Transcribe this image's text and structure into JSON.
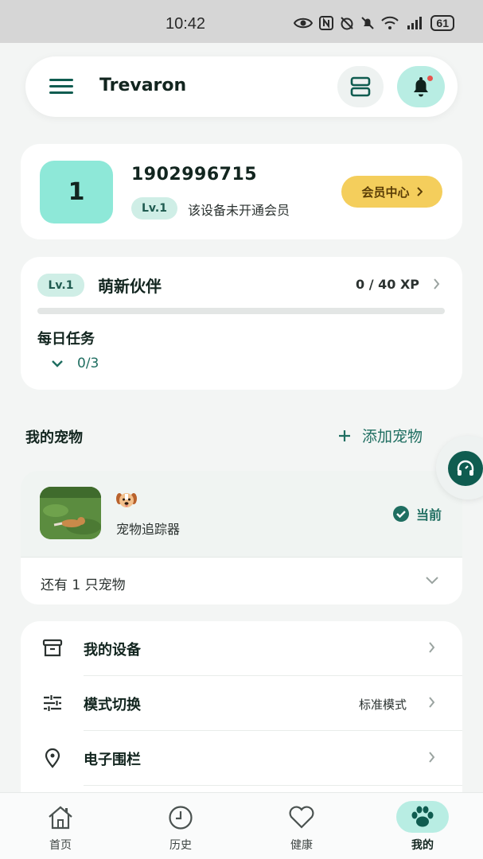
{
  "status_bar": {
    "time": "10:42",
    "battery": "61"
  },
  "header": {
    "app_name": "Trevaron"
  },
  "profile": {
    "avatar_text": "1",
    "user_id": "1902996715",
    "level_badge": "Lv.1",
    "member_status": "该设备未开通会员",
    "vip_button": "会员中心"
  },
  "level": {
    "badge": "Lv.1",
    "title": "萌新伙伴",
    "xp_text": "0 / 40 XP",
    "progress": 0,
    "daily_tasks_title": "每日任务",
    "daily_tasks_count": "0/3"
  },
  "pets": {
    "section_title": "我的宠物",
    "add_label": "添加宠物",
    "current_pet": {
      "emoji": "🐶",
      "name": "宠物追踪器",
      "status": "当前"
    },
    "more_pets": "还有 1 只宠物"
  },
  "menu": [
    {
      "label": "我的设备",
      "value": "",
      "icon": "device-box-icon"
    },
    {
      "label": "模式切换",
      "value": "标准模式",
      "icon": "sliders-icon"
    },
    {
      "label": "电子围栏",
      "value": "",
      "icon": "location-pin-icon"
    }
  ],
  "bottom_nav": [
    {
      "label": "首页",
      "icon": "home-icon",
      "active": false
    },
    {
      "label": "历史",
      "icon": "clock-icon",
      "active": false
    },
    {
      "label": "健康",
      "icon": "heart-icon",
      "active": false
    },
    {
      "label": "我的",
      "icon": "paw-icon",
      "active": true
    }
  ],
  "colors": {
    "primary": "#0f5c50",
    "accent_teal": "#8ee8d8",
    "vip_yellow": "#f4ce5c",
    "notification_dot": "#e8534d"
  }
}
